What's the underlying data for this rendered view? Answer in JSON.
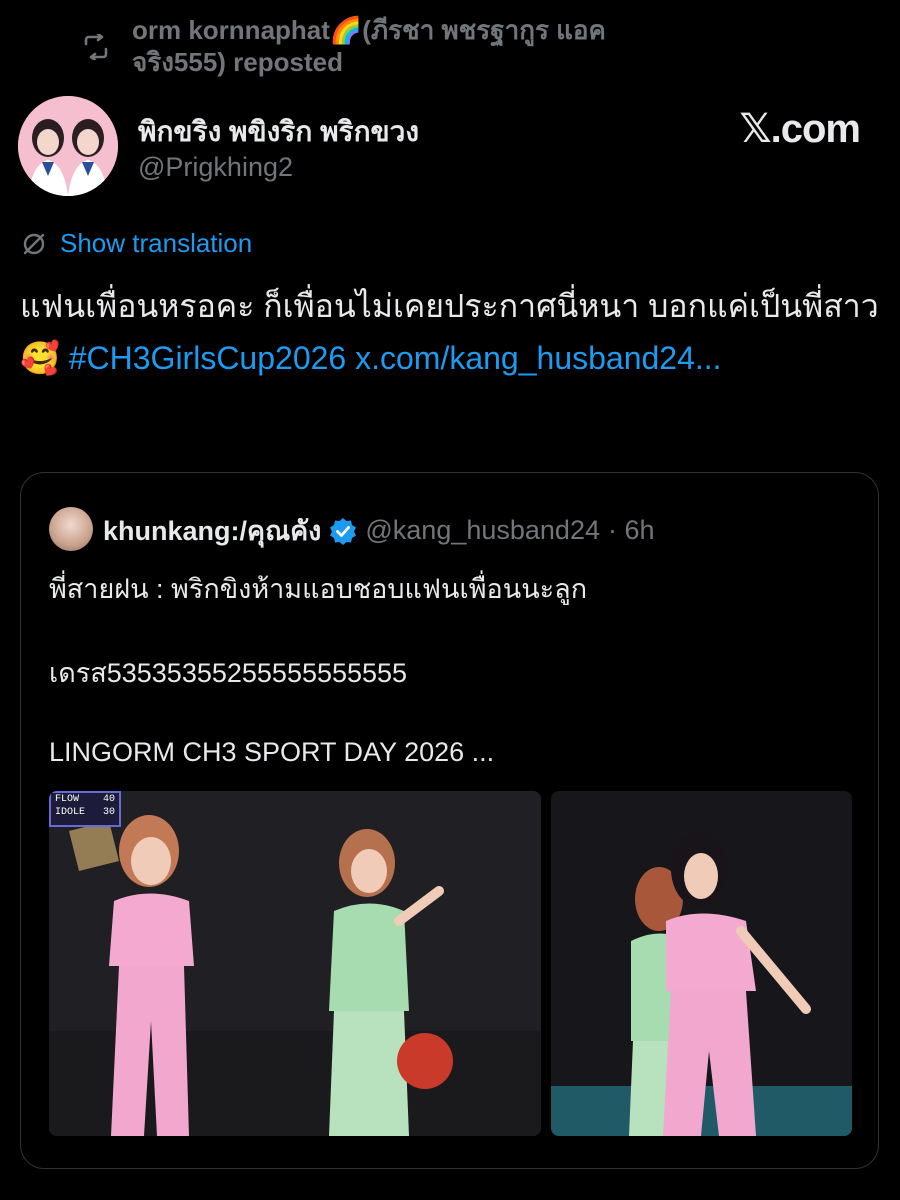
{
  "repost": {
    "text": "orm kornnaphat🌈(ภีรชา พชรฐากูร แอค จริง555) reposted"
  },
  "author": {
    "name": "พิกขริง พขิงริก พริกขวง",
    "handle": "@Prigkhing2"
  },
  "brand": "𝕏.com",
  "translation_link": "Show translation",
  "tweet": {
    "text": "แฟนเพื่อนหรอคะ ก็เพื่อนไม่เคยประกาศนี่หนา บอกแค่เป็นพี่สาว🥰 ",
    "hashtag": "#CH3GirlsCup2026",
    "link": "x.com/kang_husband24..."
  },
  "quote": {
    "name": "khunkang:/คุณคัง",
    "handle": "@kang_husband24",
    "time": "· 6h",
    "line1": "พี่สายฝน : พริกขิงห้ามแอบชอบแฟนเพื่อนนะลูก",
    "line2": "เดรส53535355255555555555",
    "line3": "LINGORM CH3 SPORT DAY 2026 ...",
    "scoreboard": [
      {
        "team": "FLOW",
        "score": "40"
      },
      {
        "team": "IDOLE",
        "score": "30"
      }
    ]
  },
  "colors": {
    "background": "#000000",
    "text": "#e7e9ea",
    "secondary": "#71767b",
    "link": "#1d9bf0",
    "verified": "#1d9bf0",
    "border": "#2f3336"
  },
  "icons": [
    "repost-icon",
    "translate-icon",
    "verified-badge-icon"
  ]
}
